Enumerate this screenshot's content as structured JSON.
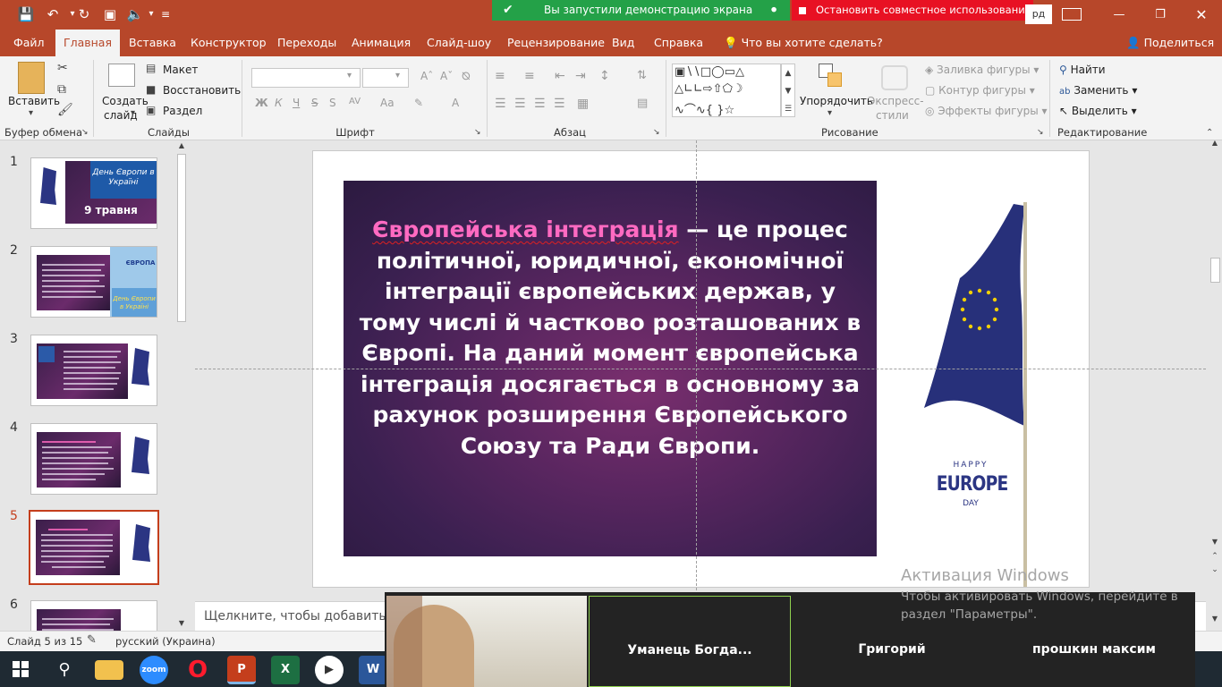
{
  "app": {
    "title_right": "рд"
  },
  "banner": {
    "sharing": "Вы запустили демонстрацию экрана",
    "stop": "Остановить совместное использование"
  },
  "tabs": [
    "Файл",
    "Главная",
    "Вставка",
    "Конструктор",
    "Переходы",
    "Анимация",
    "Слайд-шоу",
    "Рецензирование",
    "Вид",
    "Справка"
  ],
  "tell_me": "Что вы хотите сделать?",
  "share": "Поделиться",
  "ribbon": {
    "clipboard": {
      "paste": "Вставить",
      "label": "Буфер обмена"
    },
    "slides": {
      "new_slide": "Создать",
      "new_slide2": "слайд",
      "layout": "Макет",
      "reset": "Восстановить",
      "section": "Раздел",
      "label": "Слайды"
    },
    "font": {
      "label": "Шрифт",
      "bold": "Ж",
      "italic": "К",
      "underline": "Ч",
      "strike": "S",
      "spacing": "AV",
      "case": "Аа",
      "color": "А"
    },
    "paragraph": {
      "label": "Абзац"
    },
    "drawing": {
      "arrange": "Упорядочить",
      "styles": "Экспресс-",
      "styles2": "стили",
      "fill": "Заливка фигуры",
      "outline": "Контур фигуры",
      "effects": "Эффекты фигуры",
      "label": "Рисование"
    },
    "editing": {
      "find": "Найти",
      "replace": "Заменить",
      "select": "Выделить",
      "label": "Редактирование"
    }
  },
  "thumbnails": [
    {
      "num": "1",
      "title": "День Європи в Україні",
      "date": "9 травня"
    },
    {
      "num": "2",
      "banner": "ЄВРОПА",
      "caption": "День Європи в Україні"
    },
    {
      "num": "3"
    },
    {
      "num": "4"
    },
    {
      "num": "5"
    },
    {
      "num": "6"
    }
  ],
  "slide": {
    "highlight": "Європейська інтеграція",
    "rest": " — це процес політичної, юридичної, економічної інтеграції європейських держав, у тому числі й частково розташованих в Європі. На даний момент європейська інтеграція досягається в основному за рахунок розширення Європейського Союзу та Ради Європи.",
    "happy": "HAPPY",
    "europe": "EUROPE",
    "day": "DAY"
  },
  "notes_placeholder": "Щелкните, чтобы добавить за",
  "status": {
    "slide_count": "Слайд 5 из 15",
    "language": "русский (Украина)"
  },
  "zoom": {
    "p1": "Уманець  Богда...",
    "p2": "Григорий",
    "p3": "прошкин максим"
  },
  "watermark": {
    "title": "Активация Windows",
    "body": "Чтобы активировать Windows, перейдите в раздел \"Параметры\"."
  },
  "taskbar": {
    "zoom": "zoom"
  },
  "colors": {
    "accent": "#b7472a",
    "green": "#24a148",
    "red": "#e81123",
    "pink": "#ff6ac1"
  }
}
